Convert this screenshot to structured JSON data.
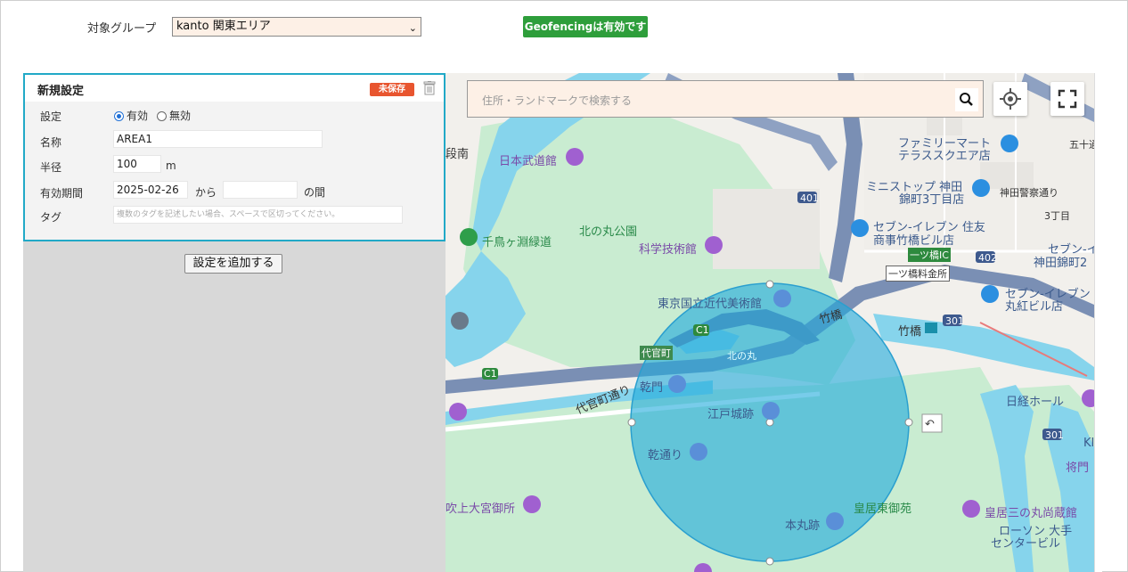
{
  "header": {
    "group_label": "対象グループ",
    "group_value": "kanto 関東エリア",
    "geofencing_status": "Geofencingは有効です"
  },
  "panel": {
    "title": "新規設定",
    "unsaved_badge": "未保存",
    "setting_label": "設定",
    "enabled_option": "有効",
    "disabled_option": "無効",
    "name_label": "名称",
    "name_value": "AREA1",
    "radius_label": "半径",
    "radius_value": "100",
    "radius_unit": "m",
    "period_label": "有効期間",
    "period_from": "2025-02-26",
    "period_from_suffix": "から",
    "period_to": "",
    "period_to_suffix": "の間",
    "tag_label": "タグ",
    "tag_placeholder": "複数のタグを記述したい場合、スペースで区切ってください。",
    "enabled_selected": true
  },
  "add_setting_button": "設定を追加する",
  "map": {
    "search_placeholder": "住所・ランドマークで検索する",
    "labels": {
      "budokan": "日本武道館",
      "kitanomaru": "北の丸公園",
      "kagaku": "科学技術館",
      "chidorigafuchi": "千鳥ヶ淵緑道",
      "kindai": "東京国立近代美術館",
      "takebashi_road": "竹橋",
      "takebashi_st": "竹橋",
      "inui": "乾門",
      "edojo": "江戸城跡",
      "inuidori": "乾通り",
      "fukiage": "吹上大宮御所",
      "kokyo_higashi": "皇居東御苑",
      "honmaru": "本丸跡",
      "sannomaru": "皇居三の丸尚蔵館",
      "lawson": "ローソン 大手",
      "lawson2": "センタービル",
      "family1": "ファミリーマート",
      "family2": "テラススクエア店",
      "ministop1": "ミニストップ 神田",
      "ministop2": "錦町3丁目店",
      "seven1": "セブン-イレブン 住友",
      "seven2": "商事竹橋ビル店",
      "seven3": "セブン-イレブン",
      "seven4": "丸紅ビル店",
      "seven5": "セブン-イ",
      "seven6": "神田錦町2",
      "kanda_police": "神田警察通り",
      "sanchome": "3丁目",
      "gochome": "五十通り",
      "hitotsubashi_ic": "一ツ橋IC",
      "hitotsubashi_toll": "一ツ橋料金所",
      "nikkei": "日経ホール",
      "shomon": "将門",
      "daikan": "代官町通り",
      "daikancho": "代官町",
      "kitanomaru_tag": "北の丸",
      "route401": "401",
      "route402": "402",
      "route301a": "301",
      "route301b": "301",
      "c1a": "C1",
      "c1b": "C1",
      "danna": "段南",
      "kl": "KI"
    }
  }
}
